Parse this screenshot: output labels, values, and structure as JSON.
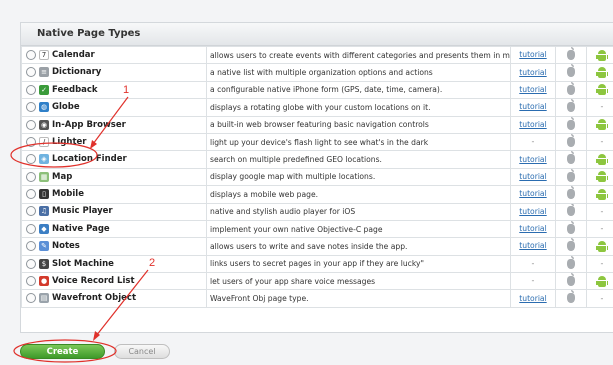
{
  "panel": {
    "title": "Native Page Types"
  },
  "rows": [
    {
      "name": "Calendar",
      "icon": "calendar-icon",
      "icon_color": "#ffffff",
      "icon_glyph": "7",
      "description": "allows users to create events with different categories and presents them in month, day and list/agenda views.",
      "tutorial": "tutorial",
      "ios": true,
      "android": true
    },
    {
      "name": "Dictionary",
      "icon": "dictionary-icon",
      "icon_color": "#9aa0a6",
      "icon_glyph": "≡",
      "description": "a native list with multiple organization options and actions",
      "tutorial": "tutorial",
      "ios": true,
      "android": true
    },
    {
      "name": "Feedback",
      "icon": "feedback-icon",
      "icon_color": "#3a9b3a",
      "icon_glyph": "✓",
      "description": "a configurable native iPhone form (GPS, date, time, camera).",
      "tutorial": "tutorial",
      "ios": true,
      "android": true
    },
    {
      "name": "Globe",
      "icon": "globe-icon",
      "icon_color": "#2f80c9",
      "icon_glyph": "◍",
      "description": "displays a rotating globe with your custom locations on it.",
      "tutorial": "tutorial",
      "ios": true,
      "android": false
    },
    {
      "name": "In-App Browser",
      "icon": "browser-icon",
      "icon_color": "#555555",
      "icon_glyph": "◉",
      "description": "a built-in web browser featuring basic navigation controls",
      "tutorial": "tutorial",
      "ios": true,
      "android": true
    },
    {
      "name": "Lighter",
      "icon": "lighter-icon",
      "icon_color": "#ffffff",
      "icon_glyph": "/",
      "description": "light up your device's flash light to see what's in the dark",
      "tutorial": "-",
      "ios": true,
      "android": false
    },
    {
      "name": "Location Finder",
      "icon": "location-finder-icon",
      "icon_color": "#6fb3e0",
      "icon_glyph": "◈",
      "description": "search on multiple predefined GEO locations.",
      "tutorial": "tutorial",
      "ios": true,
      "android": true
    },
    {
      "name": "Map",
      "icon": "map-icon",
      "icon_color": "#8cc07a",
      "icon_glyph": "▦",
      "description": "display google map with multiple locations.",
      "tutorial": "tutorial",
      "ios": true,
      "android": true
    },
    {
      "name": "Mobile",
      "icon": "mobile-icon",
      "icon_color": "#333333",
      "icon_glyph": "▯",
      "description": "displays a mobile web page.",
      "tutorial": "tutorial",
      "ios": true,
      "android": true
    },
    {
      "name": "Music Player",
      "icon": "music-player-icon",
      "icon_color": "#4a6fa5",
      "icon_glyph": "♫",
      "description": "native and stylish audio player for iOS",
      "tutorial": "tutorial",
      "ios": true,
      "android": false
    },
    {
      "name": "Native Page",
      "icon": "native-page-icon",
      "icon_color": "#3c7fc4",
      "icon_glyph": "◆",
      "description": "implement your own native Objective-C page",
      "tutorial": "tutorial",
      "ios": true,
      "android": false
    },
    {
      "name": "Notes",
      "icon": "notes-icon",
      "icon_color": "#5b8fd6",
      "icon_glyph": "✎",
      "description": "allows users to write and save notes inside the app.",
      "tutorial": "tutorial",
      "ios": true,
      "android": true
    },
    {
      "name": "Slot Machine",
      "icon": "slot-machine-icon",
      "icon_color": "#444444",
      "icon_glyph": "$",
      "description": "links users to secret pages in your app if they are lucky\"",
      "tutorial": "-",
      "ios": true,
      "android": false
    },
    {
      "name": "Voice Record List",
      "icon": "voice-record-icon",
      "icon_color": "#d33a2c",
      "icon_glyph": "●",
      "description": "let users of your app share voice messages",
      "tutorial": "-",
      "ios": true,
      "android": true
    },
    {
      "name": "Wavefront Object",
      "icon": "wavefront-icon",
      "icon_color": "#9aa3ab",
      "icon_glyph": "▤",
      "description": "WaveFront Obj page type.",
      "tutorial": "tutorial",
      "ios": true,
      "android": false
    }
  ],
  "actions": {
    "create_label": "Create",
    "cancel_label": "Cancel"
  },
  "annotations": {
    "marker_1": "1",
    "marker_2": "2",
    "color": "#e0312b"
  }
}
